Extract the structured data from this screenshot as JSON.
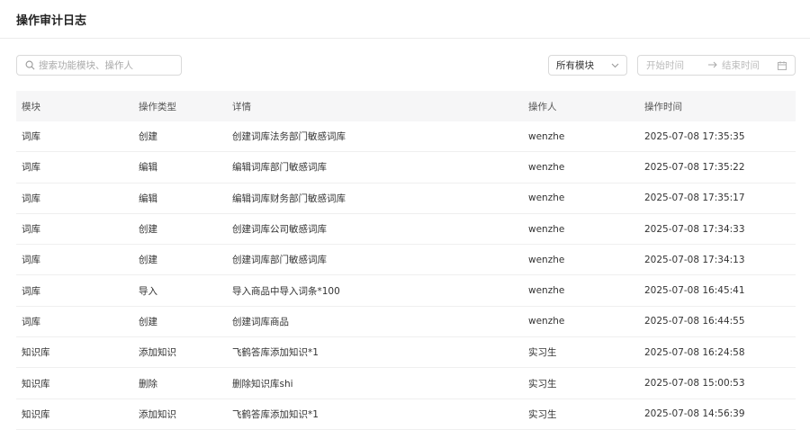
{
  "page": {
    "title": "操作审计日志"
  },
  "toolbar": {
    "search_placeholder": "搜索功能模块、操作人",
    "module_select": "所有模块",
    "start_placeholder": "开始时间",
    "end_placeholder": "结束时间"
  },
  "table": {
    "headers": [
      "模块",
      "操作类型",
      "详情",
      "操作人",
      "操作时间"
    ],
    "rows": [
      {
        "module": "词库",
        "type": "创建",
        "detail": "创建词库法务部门敏感词库",
        "operator": "wenzhe",
        "time": "2025-07-08 17:35:35"
      },
      {
        "module": "词库",
        "type": "编辑",
        "detail": "编辑词库部门敏感词库",
        "operator": "wenzhe",
        "time": "2025-07-08 17:35:22"
      },
      {
        "module": "词库",
        "type": "编辑",
        "detail": "编辑词库财务部门敏感词库",
        "operator": "wenzhe",
        "time": "2025-07-08 17:35:17"
      },
      {
        "module": "词库",
        "type": "创建",
        "detail": "创建词库公司敏感词库",
        "operator": "wenzhe",
        "time": "2025-07-08 17:34:33"
      },
      {
        "module": "词库",
        "type": "创建",
        "detail": "创建词库部门敏感词库",
        "operator": "wenzhe",
        "time": "2025-07-08 17:34:13"
      },
      {
        "module": "词库",
        "type": "导入",
        "detail": "导入商品中导入词条*100",
        "operator": "wenzhe",
        "time": "2025-07-08 16:45:41"
      },
      {
        "module": "词库",
        "type": "创建",
        "detail": "创建词库商品",
        "operator": "wenzhe",
        "time": "2025-07-08 16:44:55"
      },
      {
        "module": "知识库",
        "type": "添加知识",
        "detail": "飞鹤答库添加知识*1",
        "operator": "实习生",
        "time": "2025-07-08 16:24:58"
      },
      {
        "module": "知识库",
        "type": "删除",
        "detail": "删除知识库shi",
        "operator": "实习生",
        "time": "2025-07-08 15:00:53"
      },
      {
        "module": "知识库",
        "type": "添加知识",
        "detail": "飞鹤答库添加知识*1",
        "operator": "实习生",
        "time": "2025-07-08 14:56:39"
      }
    ]
  },
  "icons": {
    "search": "search-icon",
    "dropdown": "chevron-down-icon",
    "range_arrow": "arrow-right-icon",
    "calendar": "calendar-icon"
  }
}
